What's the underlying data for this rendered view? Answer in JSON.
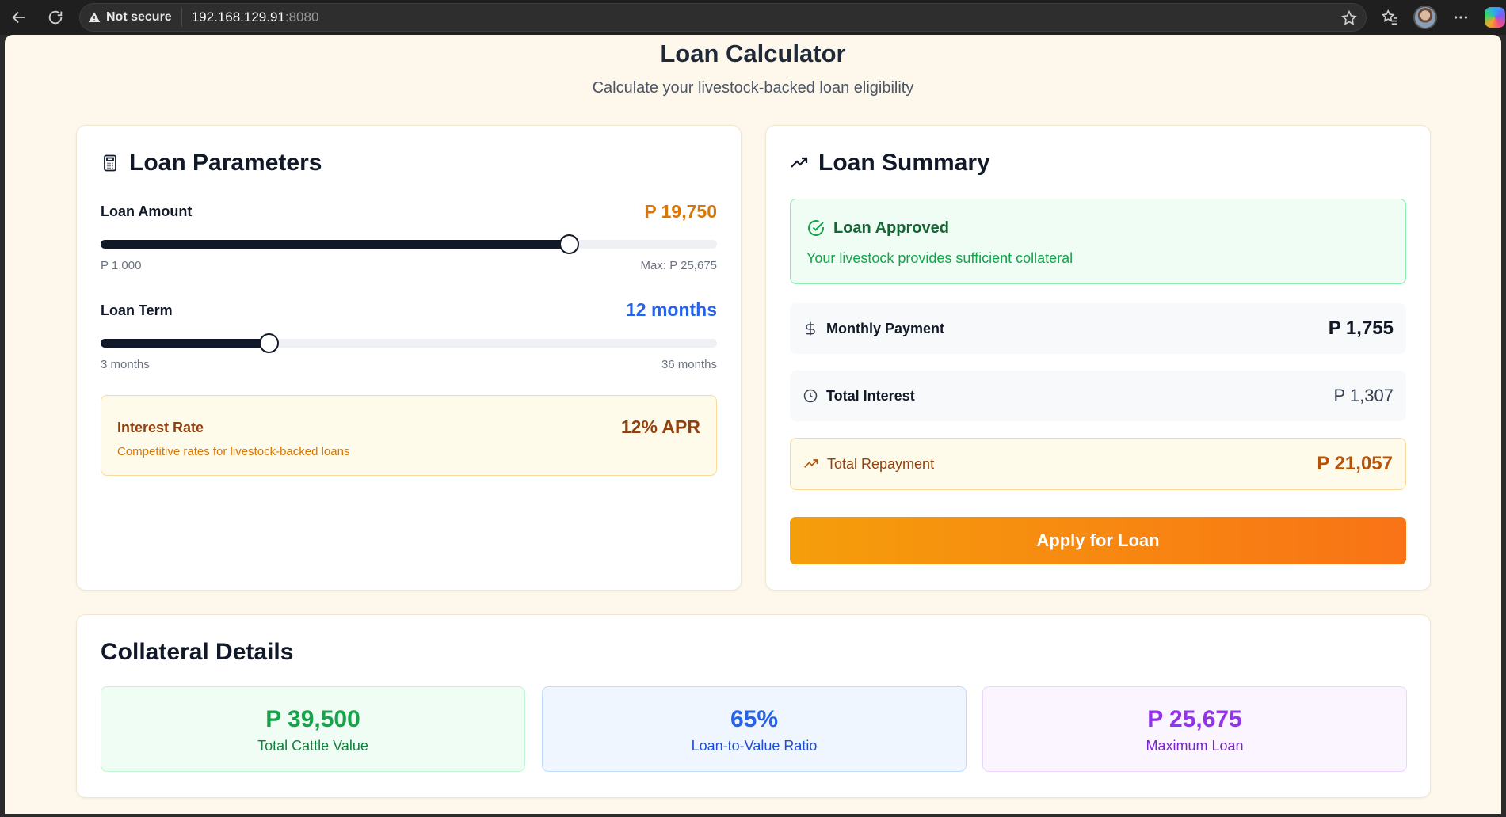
{
  "browser": {
    "security_label": "Not secure",
    "url_host": "192.168.129.91",
    "url_port": ":8080"
  },
  "page": {
    "title": "Loan Calculator",
    "subtitle": "Calculate your livestock-backed loan eligibility"
  },
  "params": {
    "heading": "Loan Parameters",
    "amount": {
      "label": "Loan Amount",
      "value": "P 19,750",
      "min_label": "P 1,000",
      "max_label": "Max: P 25,675",
      "min": 1000,
      "max": 25675,
      "current": 19750
    },
    "term": {
      "label": "Loan Term",
      "value": "12 months",
      "min_label": "3 months",
      "max_label": "36 months",
      "min": 3,
      "max": 36,
      "current": 12
    },
    "interest": {
      "title": "Interest Rate",
      "subtitle": "Competitive rates for livestock-backed loans",
      "rate": "12% APR"
    }
  },
  "summary": {
    "heading": "Loan Summary",
    "status_title": "Loan Approved",
    "status_text": "Your livestock provides sufficient collateral",
    "monthly_label": "Monthly Payment",
    "monthly_value": "P 1,755",
    "interest_label": "Total Interest",
    "interest_value": "P 1,307",
    "repay_label": "Total Repayment",
    "repay_value": "P 21,057",
    "apply_label": "Apply for Loan"
  },
  "collateral": {
    "heading": "Collateral Details",
    "tiles": [
      {
        "value": "P 39,500",
        "label": "Total Cattle Value"
      },
      {
        "value": "65%",
        "label": "Loan-to-Value Ratio"
      },
      {
        "value": "P 25,675",
        "label": "Maximum Loan"
      }
    ]
  },
  "colors": {
    "accent_orange": "#d97706",
    "accent_blue": "#2563eb",
    "success_green": "#16a34a",
    "purple": "#9333ea"
  }
}
